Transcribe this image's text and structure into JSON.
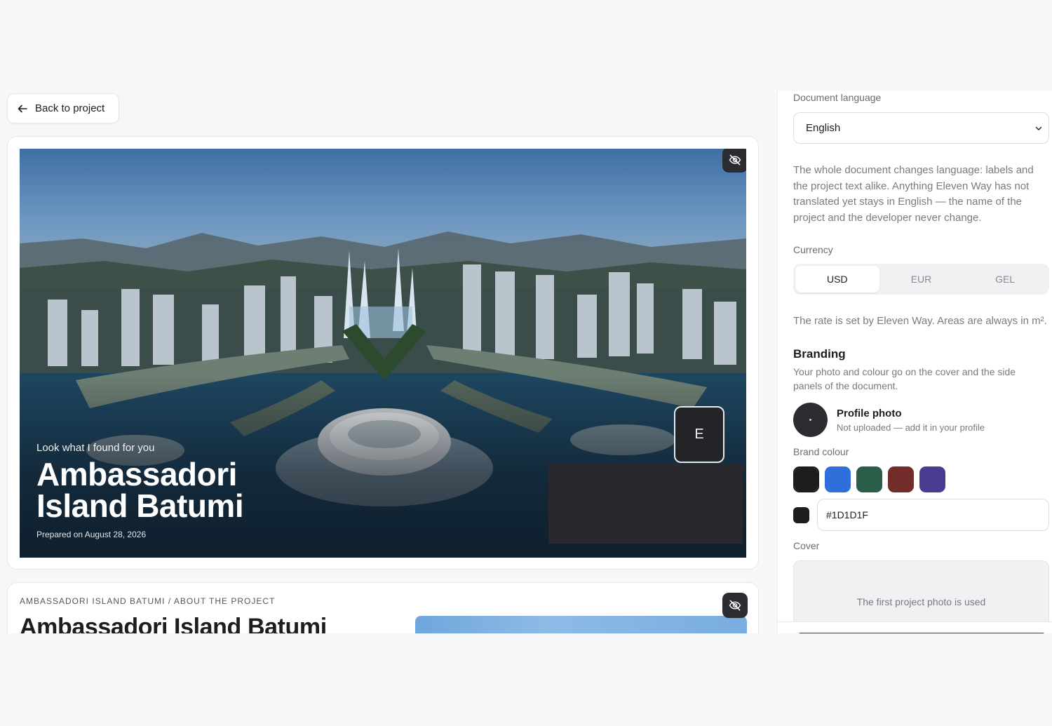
{
  "nav": {
    "back_label": "Back to project"
  },
  "cover": {
    "kicker": "Look what I found for you",
    "title": "Ambassadori Island Batumi",
    "date": "Prepared on August 28, 2026",
    "badge_letter": "E",
    "hide_icon": "eye-off-icon"
  },
  "about": {
    "breadcrumb": "AMBASSADORI ISLAND BATUMI / ABOUT THE PROJECT",
    "title": "Ambassadori Island Batumi",
    "hide_icon": "eye-off-icon"
  },
  "settings": {
    "language_label": "Document language",
    "language_value": "English",
    "language_help": "The whole document changes language: labels and the project text alike. Anything Eleven Way has not translated yet stays in English — the name of the project and the developer never change.",
    "currency_label": "Currency",
    "currencies": [
      "USD",
      "EUR",
      "GEL"
    ],
    "currency_selected": "USD",
    "currency_help": "The rate is set by Eleven Way. Areas are always in m².",
    "branding_title": "Branding",
    "branding_help": "Your photo and colour go on the cover and the side panels of the document.",
    "profile_title": "Profile photo",
    "profile_sub": "Not uploaded — add it in your profile",
    "brand_colour_label": "Brand colour",
    "brand_colours": [
      "#1D1D1F",
      "#2F6FDB",
      "#2B5E48",
      "#722D2B",
      "#4A3B91"
    ],
    "brand_colour_selected": "#1D1D1F",
    "hex_value": "#1D1D1F",
    "cover_label": "Cover",
    "cover_help": "The first project photo is used"
  }
}
